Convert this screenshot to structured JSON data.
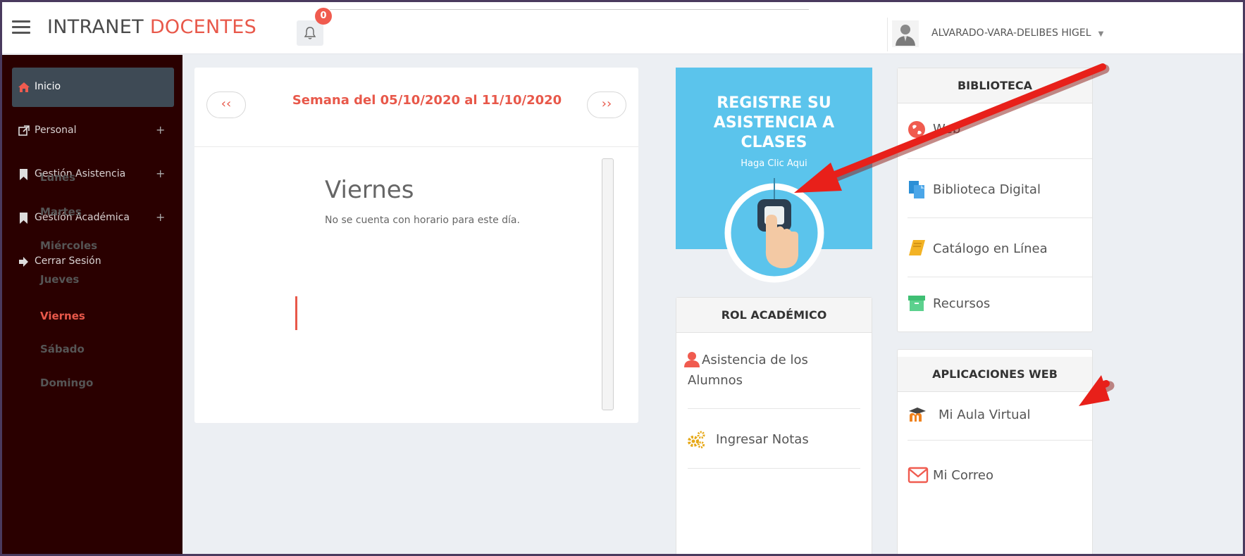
{
  "header": {
    "brand_part1": "INTRANET",
    "brand_part2": "DOCENTES",
    "notification_count": "0",
    "user_name": "ALVARADO-VARA-DELIBES HIGEL"
  },
  "sidebar": {
    "items": [
      {
        "label": "Inicio",
        "icon": "home-icon",
        "active": true
      },
      {
        "label": "Personal",
        "icon": "external-link-icon",
        "expandable": true
      },
      {
        "label": "Gestión Asistencia",
        "icon": "bookmark-icon",
        "expandable": true
      },
      {
        "label": "Gestión Académica",
        "icon": "bookmark-icon",
        "expandable": true
      },
      {
        "label": "Cerrar Sesión",
        "icon": "sign-out-icon"
      }
    ]
  },
  "schedule": {
    "prev_label": "‹‹",
    "next_label": "››",
    "week_title": "Semana del 05/10/2020 al 11/10/2020",
    "days": [
      "Lunes",
      "Martes",
      "Miércoles",
      "Jueves",
      "Viernes",
      "Sábado",
      "Domingo"
    ],
    "selected_day": "Viernes",
    "day_heading": "Viernes",
    "day_message": "No se cuenta con horario para este día."
  },
  "attendance": {
    "title_line1": "REGISTRE SU",
    "title_line2": "ASISTENCIA A",
    "title_line3": "CLASES",
    "subtitle": "Haga Clic Aqui"
  },
  "rol_academico": {
    "title": "ROL ACADÉMICO",
    "items": [
      {
        "label_line1": "Asistencia de los",
        "label_line2": "Alumnos",
        "icon": "user-icon"
      },
      {
        "label": "Ingresar Notas",
        "icon": "gears-icon"
      }
    ]
  },
  "biblioteca": {
    "title": "BIBLIOTECA",
    "items": [
      {
        "label": "Web",
        "icon": "globe-icon"
      },
      {
        "label": "Biblioteca Digital",
        "icon": "documents-icon"
      },
      {
        "label": "Catálogo en Línea",
        "icon": "book-icon"
      },
      {
        "label": "Recursos",
        "icon": "archive-icon"
      }
    ]
  },
  "aplicaciones_web": {
    "title": "APLICACIONES WEB",
    "items": [
      {
        "label": "Mi Aula Virtual",
        "icon": "moodle-icon"
      },
      {
        "label": "Mi Correo",
        "icon": "envelope-icon"
      }
    ]
  },
  "colors": {
    "accent": "#e8584a",
    "sidebar_bg": "#2a0000",
    "banner_bg": "#5bc4ec",
    "annotation_arrow": "#e8201a"
  }
}
